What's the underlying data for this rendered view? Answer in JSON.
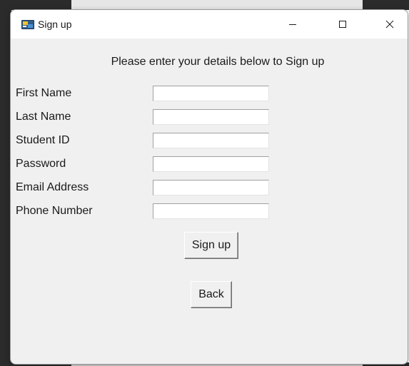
{
  "window": {
    "title": "Sign up",
    "app_icon": "python-tk-icon",
    "controls": {
      "minimize_icon": "minimize-icon",
      "maximize_icon": "maximize-icon",
      "close_icon": "close-icon"
    }
  },
  "form": {
    "heading": "Please enter your details below to Sign up",
    "fields": [
      {
        "label": "First Name",
        "value": ""
      },
      {
        "label": "Last Name",
        "value": ""
      },
      {
        "label": "Student ID",
        "value": ""
      },
      {
        "label": "Password",
        "value": ""
      },
      {
        "label": "Email Address",
        "value": ""
      },
      {
        "label": "Phone Number",
        "value": ""
      }
    ],
    "signup_label": "Sign up",
    "back_label": "Back"
  },
  "colors": {
    "window_bg": "#f0f0f0",
    "titlebar_bg": "#ffffff",
    "text": "#1a1a1a"
  }
}
